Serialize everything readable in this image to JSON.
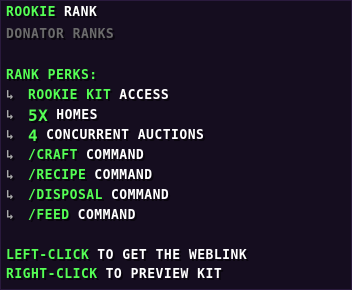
{
  "header": {
    "rank_name": "ROOKIE",
    "rank_suffix": "RANK",
    "subtitle": "DONATOR RANKS"
  },
  "perks": {
    "heading": "RANK PERKS:",
    "arrow_glyph": "↳",
    "items": [
      {
        "highlight": "ROOKIE KIT",
        "text": "ACCESS"
      },
      {
        "highlight": "5x",
        "text": "HOMES"
      },
      {
        "highlight": "4",
        "text": "CONCURRENT AUCTIONS"
      },
      {
        "highlight": "/CRAFT",
        "text": "COMMAND"
      },
      {
        "highlight": "/RECIPE",
        "text": "COMMAND"
      },
      {
        "highlight": "/DISPOSAL",
        "text": "COMMAND"
      },
      {
        "highlight": "/FEED",
        "text": "COMMAND"
      }
    ]
  },
  "actions": {
    "left_click_key": "LEFT-CLICK",
    "left_click_text": "TO GET THE WEBLINK",
    "right_click_key": "RIGHT-CLICK",
    "right_click_text": "TO PREVIEW KIT"
  },
  "colors": {
    "background": "#150d1f",
    "highlight": "#55ff55",
    "text": "#ffffff",
    "muted": "#6b6b6b",
    "arrow": "#aaaaaa"
  }
}
